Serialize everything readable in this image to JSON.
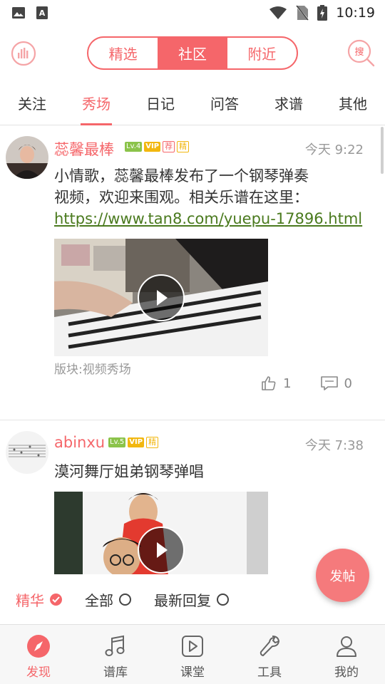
{
  "status_bar": {
    "time": "10:19"
  },
  "header": {
    "segments": [
      "精选",
      "社区",
      "附近"
    ],
    "active_segment": "社区",
    "search_icon_label": "搜"
  },
  "categories": [
    "关注",
    "秀场",
    "日记",
    "问答",
    "求谱",
    "其他"
  ],
  "active_category": "秀场",
  "posts": [
    {
      "username": "蕊馨最棒",
      "level": "Lv.4",
      "vip": "VIP",
      "tag_recommend": "荐",
      "tag_featured": "精",
      "time": "今天 9:22",
      "text_line1": "小情歌，蕊馨最棒发布了一个钢琴弹奏",
      "text_line2": "视频，欢迎来围观。相关乐谱在这里：",
      "link": "https://www.tan8.com/yuepu-17896.html",
      "section": "版块:视频秀场",
      "likes": "1",
      "comments": "0"
    },
    {
      "username": "abinxu",
      "level": "Lv.5",
      "vip": "VIP",
      "tag_featured": "精",
      "time": "今天 7:38",
      "text": "漠河舞厅姐弟钢琴弹唱"
    }
  ],
  "filter": {
    "options": [
      "精华",
      "全部",
      "最新回复"
    ],
    "selected": "精华"
  },
  "fab_label": "发帖",
  "bottom_nav": [
    "发现",
    "谱库",
    "课堂",
    "工具",
    "我的"
  ],
  "active_nav": "发现",
  "colors": {
    "accent": "#f5666a",
    "link": "#4a7a1e",
    "vip": "#f2b70f",
    "level": "#8bc34a"
  }
}
